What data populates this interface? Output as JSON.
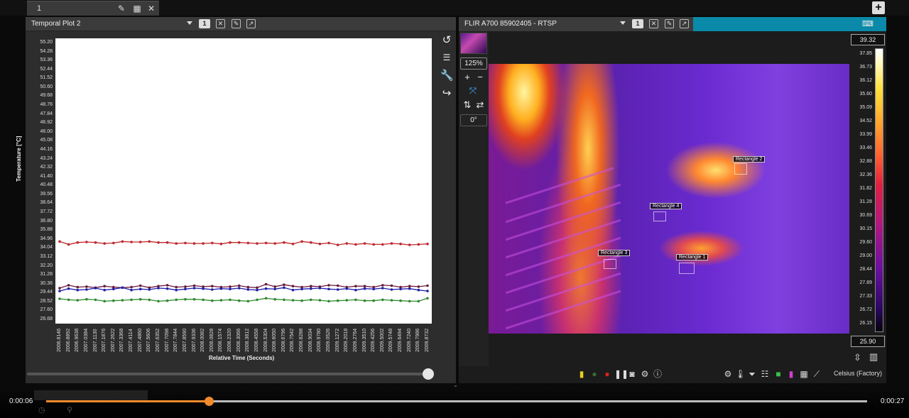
{
  "tabbar": {
    "tab_title": "1"
  },
  "left_panel": {
    "title": "Temporal Plot 2",
    "badge": "1",
    "toolbar_icons": [
      "close-icon",
      "edit-icon",
      "popout-icon"
    ],
    "side_tools": [
      "undo-icon",
      "sort-bars-icon",
      "wrench-icon",
      "redo-icon"
    ]
  },
  "chart_data": {
    "type": "line",
    "xlabel": "Relative Time (Seconds)",
    "ylabel": "Temperature [°C]",
    "ylim": [
      26.68,
      55.2
    ],
    "y_ticks": [
      "55.20",
      "54.28",
      "53.36",
      "52.44",
      "51.52",
      "50.60",
      "49.68",
      "48.76",
      "47.84",
      "46.92",
      "46.00",
      "45.08",
      "44.16",
      "43.24",
      "42.32",
      "41.40",
      "40.48",
      "39.56",
      "38.64",
      "37.72",
      "36.80",
      "35.88",
      "34.96",
      "34.04",
      "33.12",
      "32.20",
      "31.28",
      "30.36",
      "29.44",
      "28.52",
      "27.60",
      "26.68"
    ],
    "x_ticks": [
      "2006.8146",
      "2006.8892",
      "2006.9638",
      "2007.0384",
      "2007.1130",
      "2007.1876",
      "2007.2622",
      "2007.3368",
      "2007.4114",
      "2007.4860",
      "2007.5606",
      "2007.6352",
      "2007.7098",
      "2007.7844",
      "2007.8590",
      "2007.9336",
      "2008.0082",
      "2008.0828",
      "2008.1574",
      "2008.2320",
      "2008.3066",
      "2008.3812",
      "2008.4558",
      "2008.5304",
      "2008.6050",
      "2008.6796",
      "2008.7542",
      "2008.8288",
      "2008.9034",
      "2008.9780",
      "2009.0526",
      "2009.1272",
      "2009.2018",
      "2009.2764",
      "2009.3510",
      "2009.4256",
      "2009.5002",
      "2009.5748",
      "2009.6494",
      "2009.7240",
      "2009.7986",
      "2009.8732"
    ],
    "grid": false,
    "series": [
      {
        "color": "#c0282d",
        "values": [
          34.7,
          34.4,
          34.6,
          34.65,
          34.6,
          34.5,
          34.55,
          34.7,
          34.65,
          34.65,
          34.7,
          34.6,
          34.6,
          34.5,
          34.55,
          34.5,
          34.5,
          34.55,
          34.45,
          34.6,
          34.6,
          34.55,
          34.5,
          34.55,
          34.5,
          34.6,
          34.45,
          34.7,
          34.6,
          34.45,
          34.55,
          34.35,
          34.5,
          34.4,
          34.5,
          34.4,
          34.4,
          34.5,
          34.45,
          34.35,
          34.4,
          34.45
        ]
      },
      {
        "color": "#6a1a3a",
        "values": [
          29.9,
          30.2,
          30.0,
          30.05,
          29.95,
          30.1,
          30.0,
          29.95,
          30.0,
          30.15,
          29.95,
          30.1,
          30.2,
          30.0,
          30.05,
          30.15,
          30.05,
          30.1,
          30.0,
          30.05,
          30.15,
          30.0,
          29.95,
          30.3,
          30.05,
          30.25,
          30.1,
          30.0,
          30.1,
          30.05,
          30.2,
          30.15,
          30.0,
          30.1,
          30.1,
          30.0,
          30.2,
          30.15,
          30.0,
          30.1,
          30.05,
          30.15
        ]
      },
      {
        "color": "#2020a8",
        "values": [
          29.6,
          29.85,
          29.7,
          29.75,
          29.9,
          29.7,
          29.8,
          29.95,
          29.7,
          29.8,
          29.75,
          29.9,
          29.85,
          29.7,
          29.8,
          29.9,
          29.85,
          29.75,
          29.85,
          29.8,
          29.9,
          29.75,
          29.7,
          29.85,
          29.8,
          29.95,
          29.7,
          29.8,
          29.85,
          29.9,
          29.8,
          29.75,
          29.85,
          29.7,
          29.85,
          29.8,
          29.9,
          29.75,
          29.8,
          29.85,
          29.7,
          29.6
        ]
      },
      {
        "color": "#2e8a2e",
        "values": [
          28.8,
          28.7,
          28.65,
          28.75,
          28.7,
          28.55,
          28.6,
          28.65,
          28.7,
          28.75,
          28.7,
          28.55,
          28.6,
          28.7,
          28.75,
          28.75,
          28.7,
          28.6,
          28.65,
          28.7,
          28.6,
          28.55,
          28.7,
          28.85,
          28.75,
          28.7,
          28.65,
          28.6,
          28.7,
          28.65,
          28.55,
          28.6,
          28.65,
          28.7,
          28.6,
          28.6,
          28.7,
          28.65,
          28.6,
          28.55,
          28.55,
          28.85
        ]
      }
    ]
  },
  "right_panel": {
    "title": "FLIR A700 85902405 - RTSP",
    "badge": "1",
    "zoom": "125%",
    "rotation": "0°",
    "scale_max": "39.32",
    "scale_min": "25.90",
    "colorbar_ticks": [
      "37.85",
      "36.73",
      "36.12",
      "35.60",
      "35.09",
      "34.52",
      "33.99",
      "33.46",
      "32.88",
      "32.36",
      "31.82",
      "31.28",
      "30.69",
      "30.15",
      "29.60",
      "29.00",
      "28.44",
      "27.89",
      "27.33",
      "26.72",
      "26.15"
    ],
    "roi_labels": [
      "Rectangle 2",
      "Rectangle 4",
      "Rectangle 3",
      "Rectangle 1"
    ],
    "unit": "Celsius (Factory)"
  },
  "player": {
    "current_time": "0:00:06",
    "total_time": "0:00:27",
    "progress": 0.198
  }
}
